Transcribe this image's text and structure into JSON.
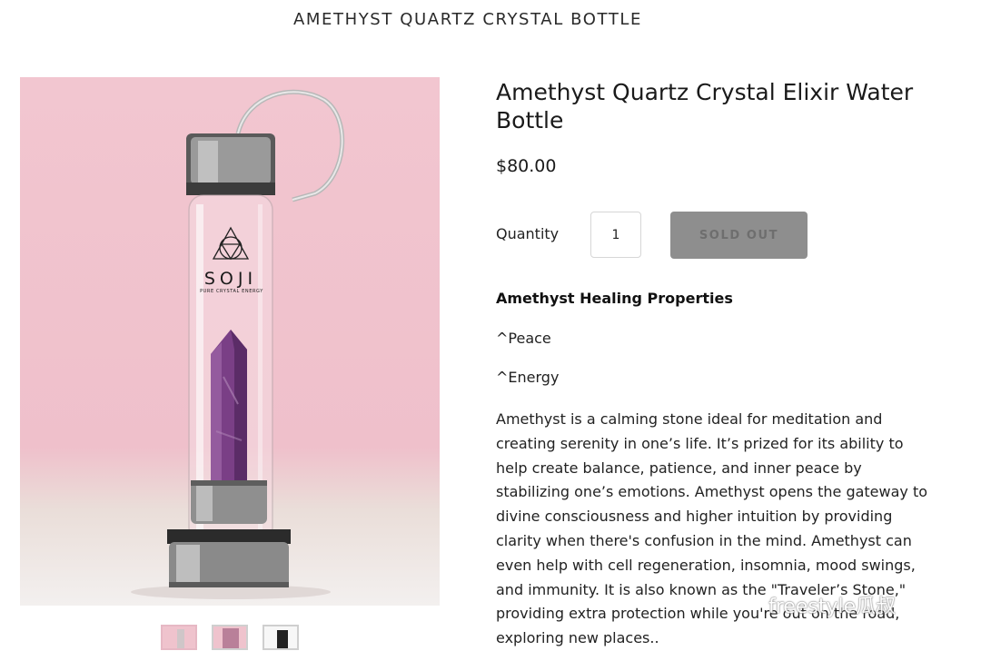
{
  "header": {
    "title": "AMETHYST QUARTZ CRYSTAL BOTTLE"
  },
  "product": {
    "title": "Amethyst Quartz Crystal Elixir Water Bottle",
    "price": "$80.00",
    "bottle_brand": "SOJI",
    "bottle_tagline": "PURE CRYSTAL ENERGY",
    "quantity_label": "Quantity",
    "quantity_value": "1",
    "sold_out_label": "SOLD OUT"
  },
  "gallery": {
    "thumbnail_count": 3,
    "selected_index": 0
  },
  "description": {
    "heading": "Amethyst Healing Properties",
    "properties": [
      "^Peace",
      "^Energy"
    ],
    "body": "Amethyst is a calming stone ideal for meditation and creating serenity in one’s life. It’s prized for its ability to help create balance, patience, and inner peace by stabilizing one’s emotions. Amethyst opens the gateway to divine consciousness and higher intuition by providing clarity when there's confusion in the mind. Amethyst can even help with cell regeneration, insomnia, mood swings, and immunity. It is also known as the \"Traveler’s Stone,\" providing extra protection while you're out on the road, exploring new places.."
  },
  "watermark": {
    "text": "freestyle瓜叔"
  },
  "colors": {
    "background_pink": "#efc0cb",
    "sold_out_button": "#8e8e8e",
    "amethyst": "#7a3f86"
  }
}
